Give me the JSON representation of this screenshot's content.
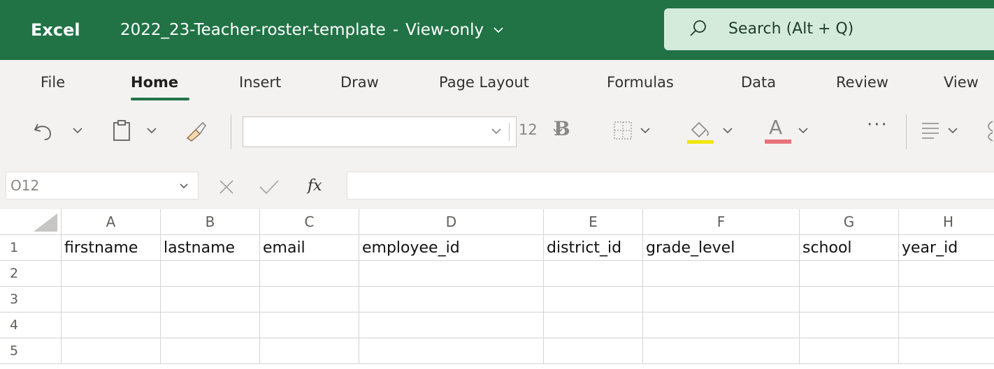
{
  "titlebar": {
    "app_name": "Excel",
    "document_title": "2022_23-Teacher-roster-template",
    "separator": "-",
    "mode": "View-only",
    "search_placeholder": "Search (Alt + Q)",
    "accent_color": "#217346"
  },
  "ribbon": {
    "tabs": [
      {
        "label": "File",
        "active": false
      },
      {
        "label": "Home",
        "active": true
      },
      {
        "label": "Insert",
        "active": false
      },
      {
        "label": "Draw",
        "active": false
      },
      {
        "label": "Page Layout",
        "active": false
      },
      {
        "label": "Formulas",
        "active": false
      },
      {
        "label": "Data",
        "active": false
      },
      {
        "label": "Review",
        "active": false
      },
      {
        "label": "View",
        "active": false
      }
    ]
  },
  "toolbar": {
    "undo_icon": "undo-icon",
    "paste_icon": "clipboard-icon",
    "format_painter_icon": "format-painter-icon",
    "font_name": "",
    "font_size": "12",
    "bold_label": "B",
    "borders_icon": "borders-icon",
    "fill_icon": "fill-color-icon",
    "fill_color": "#f2e600",
    "font_color_label": "A",
    "font_color": "#e8737a",
    "more_label": "···",
    "align_icon": "align-icon"
  },
  "formula_bar": {
    "name_box": "O12",
    "fx_label": "fx",
    "formula": ""
  },
  "grid": {
    "columns": [
      "A",
      "B",
      "C",
      "D",
      "E",
      "F",
      "G",
      "H"
    ],
    "rows": [
      {
        "number": "1",
        "cells": [
          "firstname",
          "lastname",
          "email",
          "employee_id",
          "district_id",
          "grade_level",
          "school",
          "year_id"
        ]
      },
      {
        "number": "2",
        "cells": [
          "",
          "",
          "",
          "",
          "",
          "",
          "",
          ""
        ]
      },
      {
        "number": "3",
        "cells": [
          "",
          "",
          "",
          "",
          "",
          "",
          "",
          ""
        ]
      },
      {
        "number": "4",
        "cells": [
          "",
          "",
          "",
          "",
          "",
          "",
          "",
          ""
        ]
      },
      {
        "number": "5",
        "cells": [
          "",
          "",
          "",
          "",
          "",
          "",
          "",
          ""
        ]
      }
    ]
  }
}
